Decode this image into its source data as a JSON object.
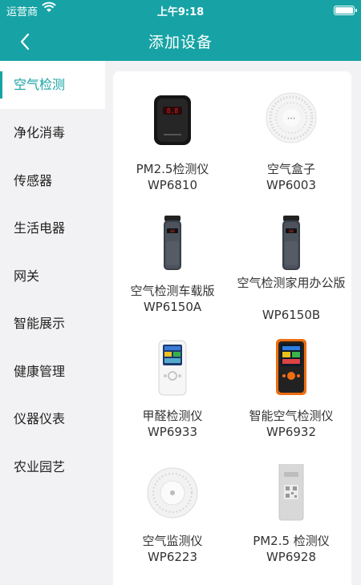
{
  "status": {
    "carrier": "运营商",
    "time": "上午9:18"
  },
  "nav": {
    "title": "添加设备"
  },
  "sidebar": {
    "items": [
      {
        "label": "空气检测",
        "active": true
      },
      {
        "label": "净化消毒"
      },
      {
        "label": "传感器"
      },
      {
        "label": "生活电器"
      },
      {
        "label": "网关"
      },
      {
        "label": "智能展示"
      },
      {
        "label": "健康管理"
      },
      {
        "label": "仪器仪表"
      },
      {
        "label": "农业园艺"
      }
    ]
  },
  "devices": [
    {
      "name": "PM2.5检测仪",
      "model": "WP6810",
      "icon": "black-pm25-meter"
    },
    {
      "name": "空气盒子",
      "model": "WP6003",
      "icon": "white-air-box"
    },
    {
      "name": "空气检测车载版",
      "model": "WP6150A",
      "icon": "car-air-detector"
    },
    {
      "name": "空气检测家用办公版",
      "model": "WP6150B",
      "icon": "home-air-detector"
    },
    {
      "name": "甲醛检测仪",
      "model": "WP6933",
      "icon": "formaldehyde-meter"
    },
    {
      "name": "智能空气检测仪",
      "model": "WP6932",
      "icon": "smart-air-meter"
    },
    {
      "name": "空气监测仪",
      "model": "WP6223",
      "icon": "round-air-monitor"
    },
    {
      "name": "PM2.5 检测仪",
      "model": "WP6928",
      "icon": "grey-pm25-meter"
    }
  ],
  "colors": {
    "accent": "#17a3a5"
  }
}
